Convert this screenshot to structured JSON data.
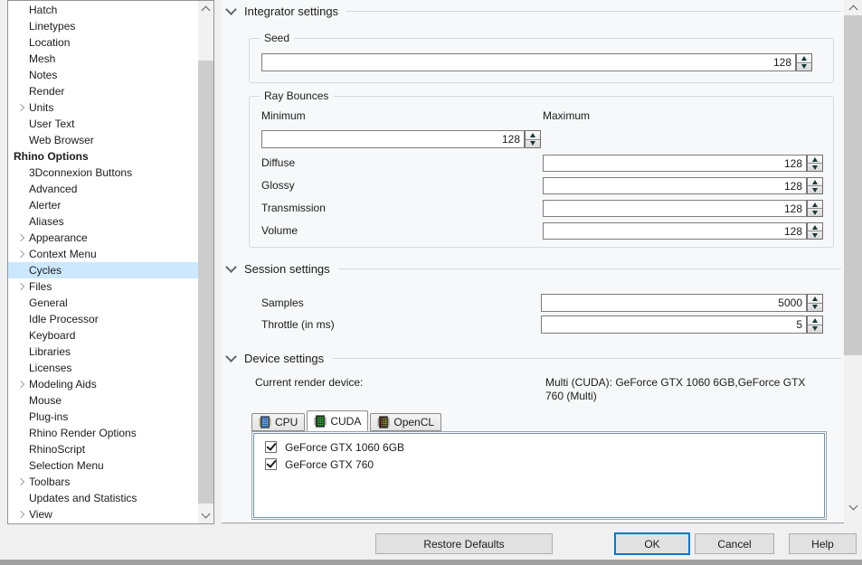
{
  "sidebar": {
    "items": [
      {
        "label": "Hatch"
      },
      {
        "label": "Linetypes"
      },
      {
        "label": "Location"
      },
      {
        "label": "Mesh"
      },
      {
        "label": "Notes"
      },
      {
        "label": "Render"
      },
      {
        "label": "Units",
        "expandable": true
      },
      {
        "label": "User Text"
      },
      {
        "label": "Web Browser"
      },
      {
        "label": "Rhino Options",
        "bold": true
      },
      {
        "label": "3Dconnexion Buttons"
      },
      {
        "label": "Advanced"
      },
      {
        "label": "Alerter"
      },
      {
        "label": "Aliases"
      },
      {
        "label": "Appearance",
        "expandable": true
      },
      {
        "label": "Context Menu",
        "expandable": true
      },
      {
        "label": "Cycles",
        "selected": true
      },
      {
        "label": "Files",
        "expandable": true
      },
      {
        "label": "General"
      },
      {
        "label": "Idle Processor"
      },
      {
        "label": "Keyboard"
      },
      {
        "label": "Libraries"
      },
      {
        "label": "Licenses"
      },
      {
        "label": "Modeling Aids",
        "expandable": true
      },
      {
        "label": "Mouse"
      },
      {
        "label": "Plug-ins"
      },
      {
        "label": "Rhino Render Options"
      },
      {
        "label": "RhinoScript"
      },
      {
        "label": "Selection Menu"
      },
      {
        "label": "Toolbars",
        "expandable": true
      },
      {
        "label": "Updates and Statistics"
      },
      {
        "label": "View",
        "expandable": true
      }
    ]
  },
  "integrator": {
    "title": "Integrator settings",
    "seed": {
      "legend": "Seed",
      "value": "128"
    },
    "ray": {
      "legend": "Ray Bounces",
      "min_label": "Minimum",
      "max_label": "Maximum",
      "min_value": "128",
      "rows": [
        {
          "label": "Diffuse",
          "value": "128"
        },
        {
          "label": "Glossy",
          "value": "128"
        },
        {
          "label": "Transmission",
          "value": "128"
        },
        {
          "label": "Volume",
          "value": "128"
        }
      ]
    }
  },
  "session": {
    "title": "Session settings",
    "rows": [
      {
        "label": "Samples",
        "value": "5000"
      },
      {
        "label": "Throttle (in ms)",
        "value": "5"
      }
    ]
  },
  "device": {
    "title": "Device settings",
    "current_label": "Current render device:",
    "current_value": "Multi (CUDA): GeForce GTX 1060 6GB,GeForce GTX 760 (Multi)",
    "tabs": [
      {
        "label": "CPU",
        "icon": "cpu-chip-icon",
        "active": false
      },
      {
        "label": "CUDA",
        "icon": "cuda-chip-icon",
        "active": true
      },
      {
        "label": "OpenCL",
        "icon": "opencl-chip-icon",
        "active": false
      }
    ],
    "devices": [
      {
        "label": "GeForce GTX 1060 6GB",
        "checked": true
      },
      {
        "label": "GeForce GTX 760",
        "checked": true
      }
    ]
  },
  "footer": {
    "restore_label": "Restore Defaults",
    "ok_label": "OK",
    "cancel_label": "Cancel",
    "help_label": "Help"
  },
  "icons": {
    "section_header": "chevron-down-icon",
    "tree_expander": "chevron-right-icon",
    "scroll_up": "chevron-up-icon",
    "scroll_down": "chevron-down-icon",
    "spinner_up": "triangle-up-icon",
    "spinner_down": "triangle-down-icon",
    "checked_item": "checkbox-checked-icon"
  },
  "colors": {
    "accent": "#0078d7",
    "selection": "#cce8ff",
    "spinner_arrow": "#173a3a"
  }
}
